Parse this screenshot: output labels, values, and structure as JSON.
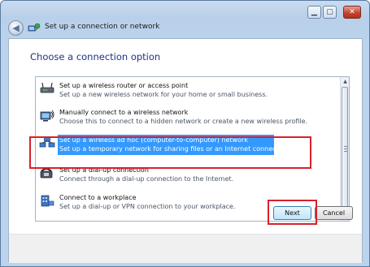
{
  "window": {
    "title": "Set up a connection or network",
    "back_icon": "back-arrow-icon",
    "app_icon": "network-icon",
    "controls": {
      "minimize": "minimize-icon",
      "maximize": "maximize-icon",
      "close": "close-icon"
    }
  },
  "main": {
    "heading": "Choose a connection option",
    "options": [
      {
        "title": "Set up a wireless router or access point",
        "desc": "Set up a new wireless network for your home or small business.",
        "icon": "router-icon"
      },
      {
        "title": "Manually connect to a wireless network",
        "desc": "Choose this to connect to a hidden network or create a new wireless profile.",
        "icon": "wireless-computer-icon"
      },
      {
        "title": "Set up a wireless ad hoc (computer-to-computer) network",
        "desc": "Set up a temporary network for sharing files or an Internet connection.",
        "icon": "adhoc-network-icon",
        "selected": true
      },
      {
        "title": "Set up a dial-up connection",
        "desc": "Connect through a dial-up connection to the Internet.",
        "icon": "dialup-phone-icon"
      },
      {
        "title": "Connect to a workplace",
        "desc": "Set up a dial-up or VPN connection to your workplace.",
        "icon": "workplace-icon"
      }
    ]
  },
  "footer": {
    "next_label": "Next",
    "cancel_label": "Cancel"
  },
  "colors": {
    "heading": "#1e3287",
    "selection": "#3399ff",
    "annotation": "#d9202c"
  }
}
